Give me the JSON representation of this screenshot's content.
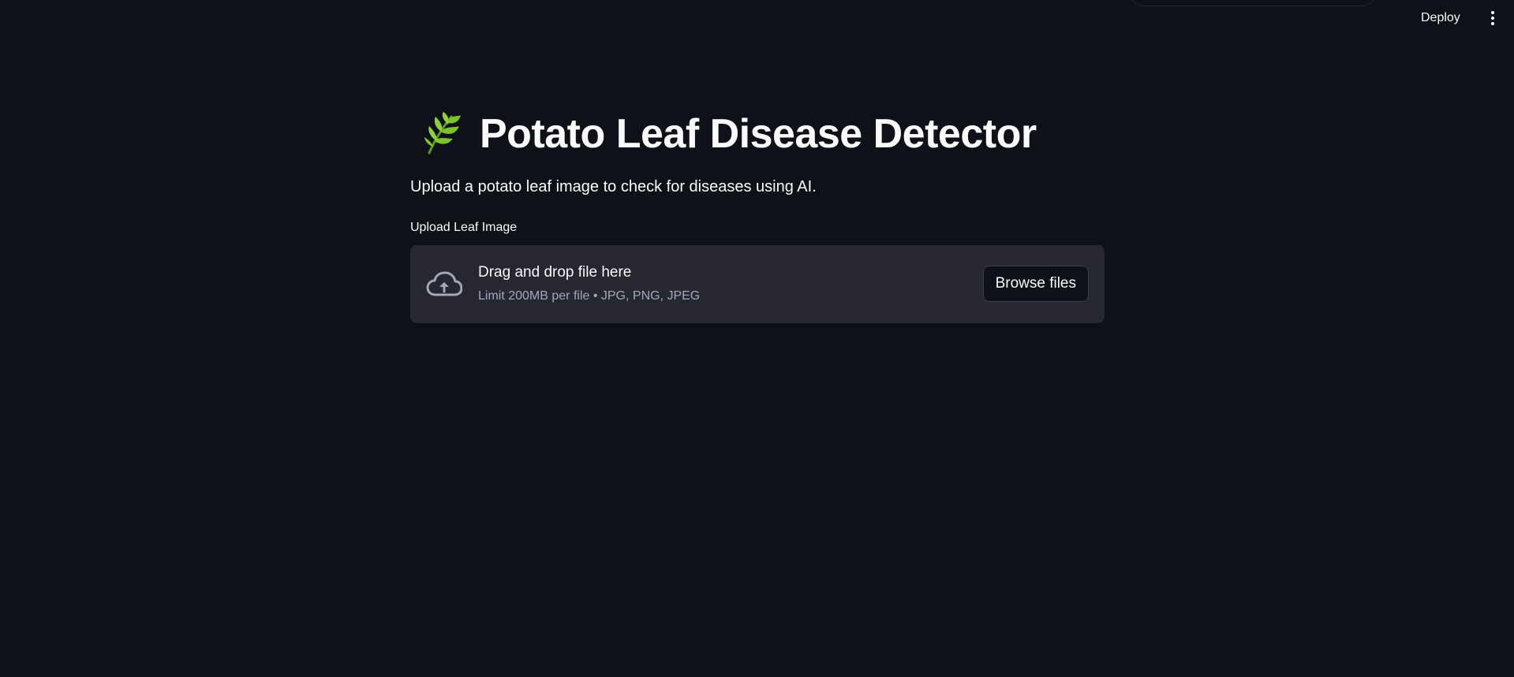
{
  "header": {
    "deploy_label": "Deploy",
    "menu_icon": "kebab-menu-icon"
  },
  "main": {
    "title_icon": "herb-icon",
    "title": "Potato Leaf Disease Detector",
    "subtitle": "Upload a potato leaf image to check for diseases using AI.",
    "uploader": {
      "label": "Upload Leaf Image",
      "icon": "cloud-upload-icon",
      "drop_title": "Drag and drop file here",
      "drop_hint": "Limit 200MB per file • JPG, PNG, JPEG",
      "browse_label": "Browse files"
    }
  },
  "colors": {
    "background": "#0e1117",
    "dropzone": "#262730",
    "text": "#fafafa",
    "muted_text": "#a3a8b8",
    "herb_green": "#7cc42a"
  }
}
